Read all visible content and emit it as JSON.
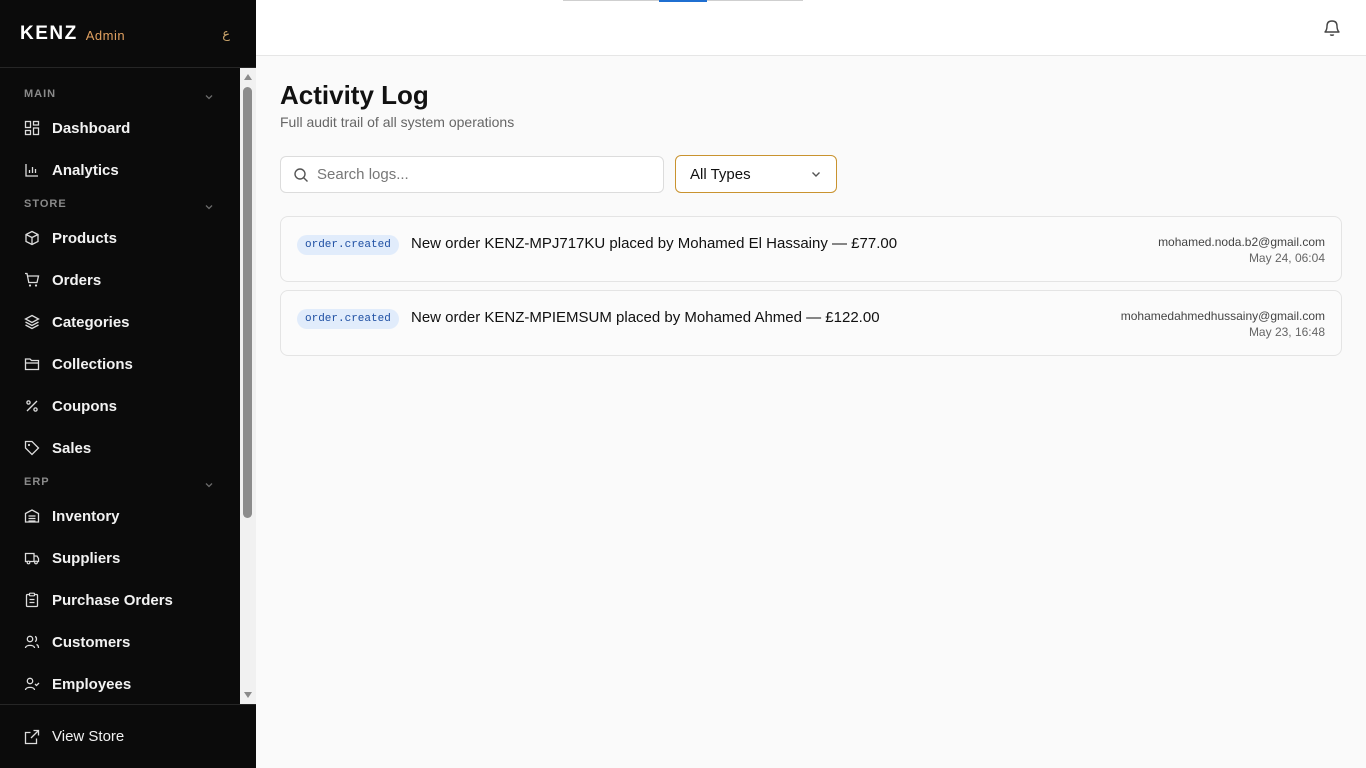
{
  "brand": {
    "name": "KENZ",
    "suffix": "Admin",
    "language_toggle": "ع"
  },
  "sidebar": {
    "sections": [
      {
        "label": "MAIN",
        "items": [
          {
            "label": "Dashboard",
            "icon": "dashboard-icon"
          },
          {
            "label": "Analytics",
            "icon": "bar-chart-icon"
          }
        ]
      },
      {
        "label": "STORE",
        "items": [
          {
            "label": "Products",
            "icon": "package-icon"
          },
          {
            "label": "Orders",
            "icon": "cart-icon"
          },
          {
            "label": "Categories",
            "icon": "layers-icon"
          },
          {
            "label": "Collections",
            "icon": "folder-icon"
          },
          {
            "label": "Coupons",
            "icon": "percent-icon"
          },
          {
            "label": "Sales",
            "icon": "tag-icon"
          }
        ]
      },
      {
        "label": "ERP",
        "items": [
          {
            "label": "Inventory",
            "icon": "warehouse-icon"
          },
          {
            "label": "Suppliers",
            "icon": "truck-icon"
          },
          {
            "label": "Purchase Orders",
            "icon": "clipboard-icon"
          },
          {
            "label": "Customers",
            "icon": "users-icon"
          },
          {
            "label": "Employees",
            "icon": "user-check-icon"
          }
        ]
      }
    ],
    "footer": {
      "label": "View Store",
      "icon": "external-link-icon"
    }
  },
  "header": {
    "bell_icon": "bell-icon"
  },
  "page": {
    "title": "Activity Log",
    "subtitle": "Full audit trail of all system operations"
  },
  "filters": {
    "search_placeholder": "Search logs...",
    "type_select": "All Types"
  },
  "logs": [
    {
      "type": "order.created",
      "message": "New order KENZ-MPJ717KU placed by Mohamed El Hassainy — £77.00",
      "user": "mohamed.noda.b2@gmail.com",
      "time": "May 24, 06:04"
    },
    {
      "type": "order.created",
      "message": "New order KENZ-MPIEMSUM placed by Mohamed Ahmed — £122.00",
      "user": "mohamedahmedhussainy@gmail.com",
      "time": "May 23, 16:48"
    }
  ],
  "colors": {
    "sidebar_bg": "#0b0b0b",
    "accent": "#c9932f",
    "badge_bg": "#e1ecfb",
    "badge_text": "#1e4fa3"
  }
}
